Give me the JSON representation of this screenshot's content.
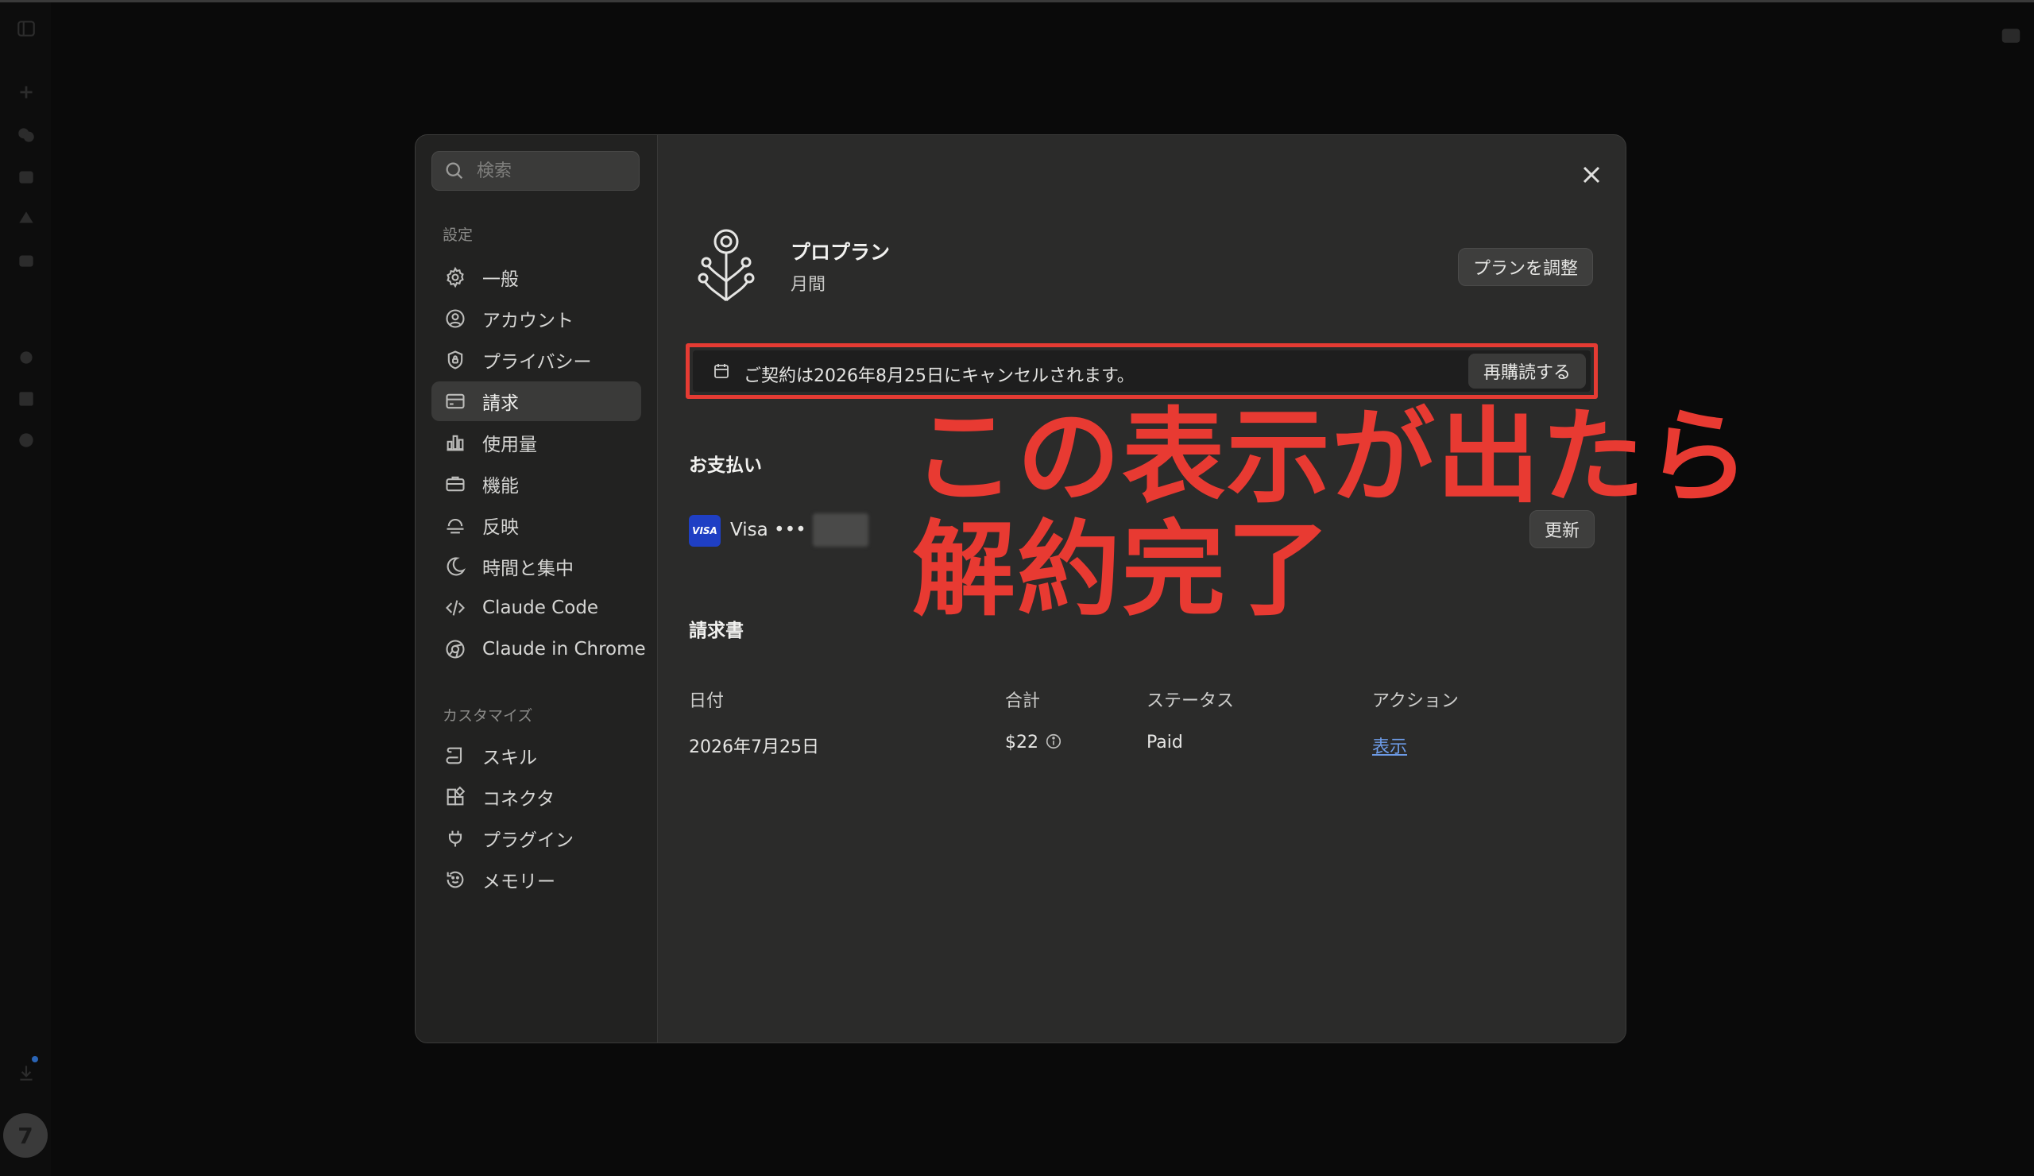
{
  "search": {
    "placeholder": "検索"
  },
  "sidebar": {
    "settings_label": "設定",
    "settings_items": [
      {
        "label": "一般",
        "icon": "gear-icon"
      },
      {
        "label": "アカウント",
        "icon": "user-circle-icon"
      },
      {
        "label": "プライバシー",
        "icon": "shield-icon"
      },
      {
        "label": "請求",
        "icon": "credit-card-icon",
        "active": true
      },
      {
        "label": "使用量",
        "icon": "bar-chart-icon"
      },
      {
        "label": "機能",
        "icon": "briefcase-icon"
      },
      {
        "label": "反映",
        "icon": "reflect-icon"
      },
      {
        "label": "時間と集中",
        "icon": "moon-icon"
      },
      {
        "label": "Claude Code",
        "icon": "code-icon"
      },
      {
        "label": "Claude in Chrome",
        "icon": "chrome-icon"
      }
    ],
    "customize_label": "カスタマイズ",
    "customize_items": [
      {
        "label": "スキル",
        "icon": "scroll-icon"
      },
      {
        "label": "コネクタ",
        "icon": "connector-icon"
      },
      {
        "label": "プラグイン",
        "icon": "plug-icon"
      },
      {
        "label": "メモリー",
        "icon": "memory-icon"
      }
    ]
  },
  "plan": {
    "name": "プロプラン",
    "period": "月間",
    "adjust_button": "プランを調整"
  },
  "notice": {
    "text": "ご契約は2026年8月25日にキャンセルされます。",
    "resubscribe_button": "再購読する"
  },
  "annotation": {
    "line1": "この表示が出たら",
    "line2": "解約完了",
    "color": "#e83a32"
  },
  "payment": {
    "heading": "お支払い",
    "card_brand": "VISA",
    "card_text": "Visa •••",
    "update_button": "更新"
  },
  "invoices": {
    "heading": "請求書",
    "columns": [
      "日付",
      "合計",
      "ステータス",
      "アクション"
    ],
    "rows": [
      {
        "date": "2026年7月25日",
        "total": "$22",
        "status": "Paid",
        "action": "表示"
      }
    ]
  },
  "avatar_letter": "7"
}
